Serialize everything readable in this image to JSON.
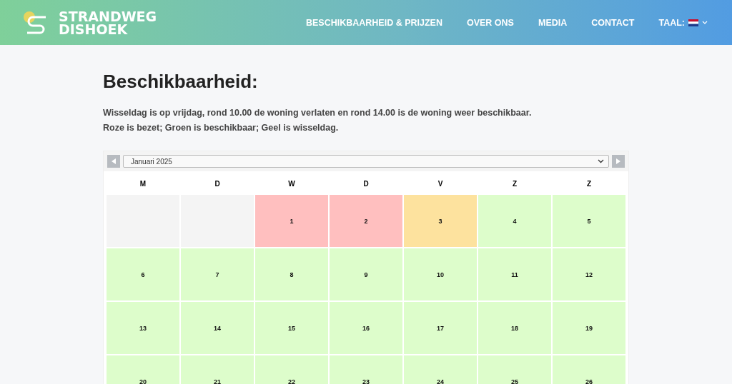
{
  "brand": {
    "line_1": "STRANDWEG",
    "line_2": "DISHOEK"
  },
  "nav": [
    {
      "label": "BESCHIKBAARHEID & PRIJZEN"
    },
    {
      "label": "OVER ONS"
    },
    {
      "label": "MEDIA"
    },
    {
      "label": "CONTACT"
    }
  ],
  "language": {
    "label": "TAAL:"
  },
  "title": "Beschikbaarheid:",
  "info": [
    "Wisseldag is op vrijdag, rond 10.00 de woning verlaten en rond 14.00 is de woning weer beschikbaar.",
    "Roze is bezet; Groen is beschikbaar; Geel is wisseldag."
  ],
  "calendar": {
    "month": "Januari 2025",
    "weekdays": [
      "M",
      "D",
      "W",
      "D",
      "V",
      "Z",
      "Z"
    ],
    "weeks": [
      [
        {
          "color": "#f4f4f4"
        },
        {
          "color": "#f4f4f4"
        },
        {
          "day": "1",
          "color": "#ffbfbf"
        },
        {
          "day": "2",
          "color": "#ffbfbf"
        },
        {
          "day": "3",
          "color": "#fde29e"
        },
        {
          "day": "4",
          "color": "#ddfdcb"
        },
        {
          "day": "5",
          "color": "#ddfdcb"
        }
      ],
      [
        {
          "day": "6",
          "color": "#ddfdcb"
        },
        {
          "day": "7",
          "color": "#ddfdcb"
        },
        {
          "day": "8",
          "color": "#ddfdcb"
        },
        {
          "day": "9",
          "color": "#ddfdcb"
        },
        {
          "day": "10",
          "color": "#ddfdcb"
        },
        {
          "day": "11",
          "color": "#ddfdcb"
        },
        {
          "day": "12",
          "color": "#ddfdcb"
        }
      ],
      [
        {
          "day": "13",
          "color": "#ddfdcb"
        },
        {
          "day": "14",
          "color": "#ddfdcb"
        },
        {
          "day": "15",
          "color": "#ddfdcb"
        },
        {
          "day": "16",
          "color": "#ddfdcb"
        },
        {
          "day": "17",
          "color": "#ddfdcb"
        },
        {
          "day": "18",
          "color": "#ddfdcb"
        },
        {
          "day": "19",
          "color": "#ddfdcb"
        }
      ],
      [
        {
          "day": "20",
          "color": "#ddfdcb"
        },
        {
          "day": "21",
          "color": "#ddfdcb"
        },
        {
          "day": "22",
          "color": "#ddfdcb"
        },
        {
          "day": "23",
          "color": "#ddfdcb"
        },
        {
          "day": "24",
          "color": "#ddfdcb"
        },
        {
          "day": "25",
          "color": "#ddfdcb"
        },
        {
          "day": "26",
          "color": "#ddfdcb"
        }
      ]
    ]
  }
}
